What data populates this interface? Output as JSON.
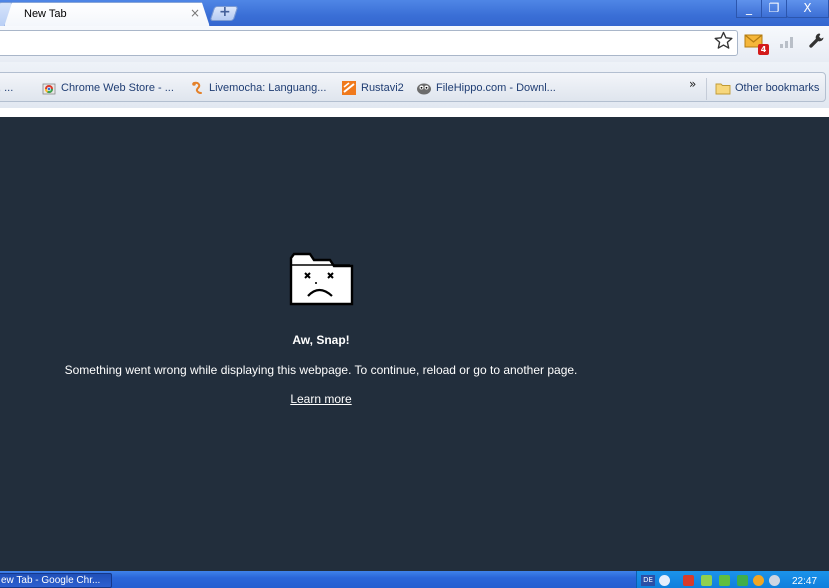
{
  "tab": {
    "title": "New Tab",
    "close_glyph": "×",
    "new_tab_glyph": "+"
  },
  "window_controls": {
    "minimize": "_",
    "maximize": "❐",
    "close": "X"
  },
  "toolbar": {
    "address_value": "",
    "extension_badge": "4"
  },
  "bookmarks": {
    "items": [
      {
        "label": ", ...",
        "icon": "bookmark-icon"
      },
      {
        "label": "Chrome Web Store - ...",
        "icon": "chrome-web-store-icon"
      },
      {
        "label": "Livemocha: Languang...",
        "icon": "livemocha-icon"
      },
      {
        "label": "Rustavi2",
        "icon": "rustavi2-icon"
      },
      {
        "label": "FileHippo.com - Downl...",
        "icon": "filehippo-icon"
      }
    ],
    "overflow_glyph": "»",
    "other_bookmarks": "Other bookmarks"
  },
  "sad_tab": {
    "title": "Aw, Snap!",
    "message": "Something went wrong while displaying this webpage. To continue, reload or go to another page.",
    "link": "Learn more"
  },
  "taskbar": {
    "task_label": "ew Tab - Google Chr...",
    "lang": "DE",
    "clock": "22:47"
  },
  "colors": {
    "content_bg": "#222e3c",
    "titlebar": "#3a6fd6",
    "bookmark_text": "#1f3d73",
    "tray": "#0f7fdd"
  }
}
